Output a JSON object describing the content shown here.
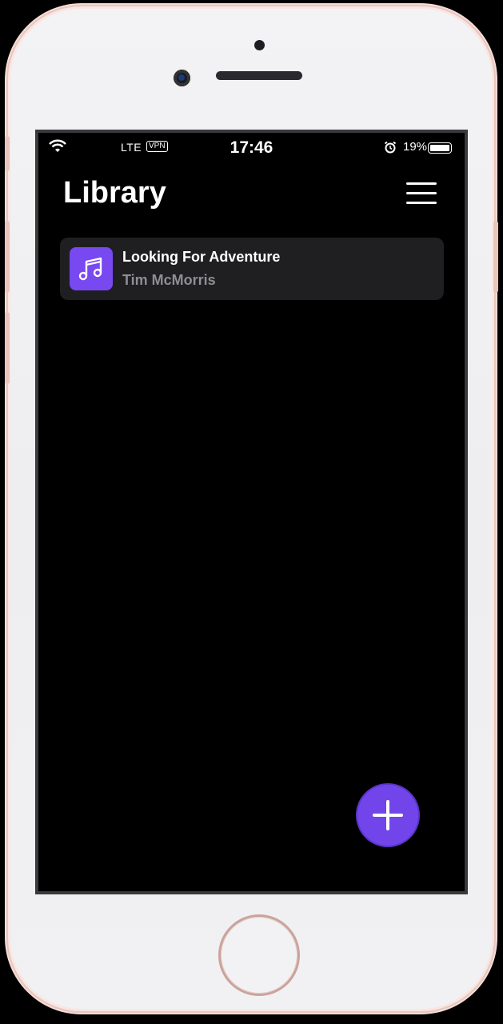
{
  "status_bar": {
    "carrier": "LTE",
    "vpn": "VPN",
    "time": "17:46",
    "battery_percent": "19%",
    "icons": [
      "wifi-icon",
      "alarm-icon",
      "battery-icon"
    ]
  },
  "header": {
    "title": "Library",
    "menu_icon": "hamburger-menu-icon"
  },
  "library": {
    "tracks": [
      {
        "title": "Looking For Adventure",
        "artist": "Tim McMorris",
        "icon": "music-note-icon"
      }
    ]
  },
  "fab": {
    "icon": "plus-icon"
  },
  "colors": {
    "accent": "#7145ea",
    "background": "#000000",
    "card": "#1f1f21",
    "secondary_text": "#8e8e93"
  }
}
